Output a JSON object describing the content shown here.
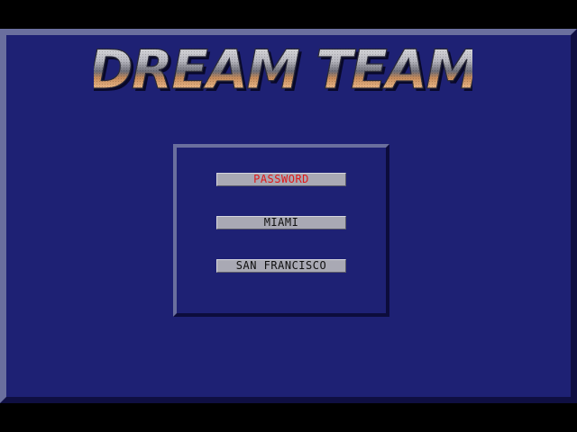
{
  "game": {
    "title": "DREAM TEAM"
  },
  "menu": {
    "items": [
      {
        "label": "PASSWORD",
        "selected": true
      },
      {
        "label": "MIAMI",
        "selected": false
      },
      {
        "label": "SAN FRANCISCO",
        "selected": false
      }
    ],
    "colors": {
      "selected_text": "#e01818",
      "normal_text": "#101010",
      "button_face": "#a9a9b4",
      "panel_blue": "#1e2174"
    }
  }
}
